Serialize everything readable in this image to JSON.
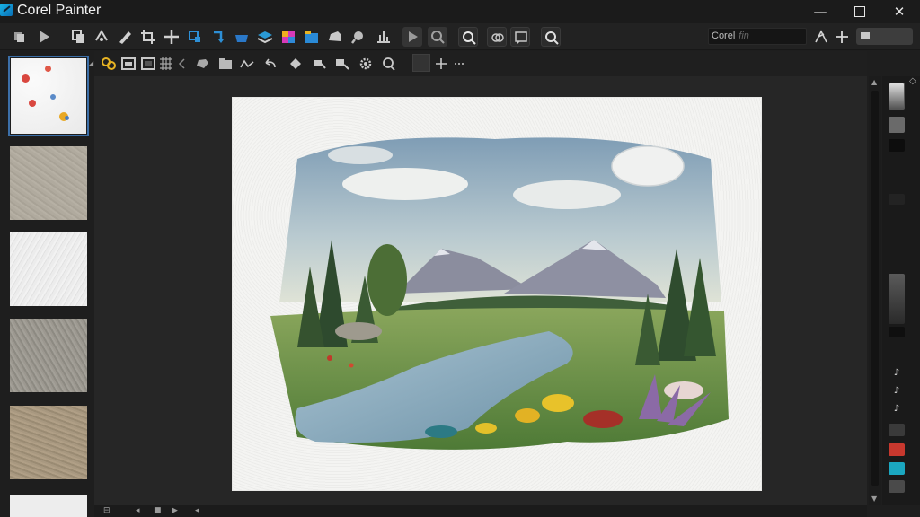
{
  "app": {
    "title": "Corel Painter"
  },
  "window_controls": {
    "minimize": "—",
    "close": "✕"
  },
  "toolbar": {
    "search_value": "Corel",
    "search_placeholder": "fin"
  },
  "icons": {
    "toolbar": [
      "layers-icon",
      "play-icon",
      "copy-icon",
      "transform-icon",
      "pen-icon",
      "crop-icon",
      "move-icon",
      "selection-icon",
      "rotate-icon",
      "paint-bucket-icon",
      "layer-stack-icon",
      "color-gradient-icon",
      "folder-icon",
      "cloud-icon",
      "eyedropper-icon",
      "graph-icon",
      "play-icon",
      "zoom-refresh-icon",
      "zoom-icon",
      "clone-icon",
      "comment-icon",
      "search-icon"
    ],
    "property_bar": [
      "link-icon",
      "image-icon",
      "frame-icon",
      "grid-icon",
      "chevron-left-icon",
      "hand-icon",
      "folder-icon",
      "brush-curve-icon",
      "undo-icon",
      "diamond-icon",
      "stamp-icon",
      "selection-icon",
      "gear-icon",
      "lasso-icon",
      "plus-icon",
      "more-icon"
    ]
  },
  "colors": {
    "accent_blue": "#3c6fa8",
    "brand_cyan": "#18b5e8",
    "right_panel_red": "#c8382e",
    "right_panel_cyan": "#1ba7c0"
  },
  "status_bar": {
    "items": [
      "⊟",
      "◂",
      "■",
      "▶",
      "◂"
    ]
  }
}
